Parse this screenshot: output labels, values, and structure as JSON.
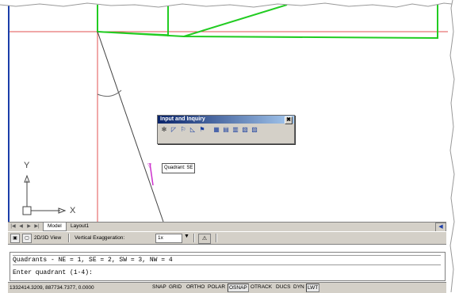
{
  "ucs": {
    "x_axis": "X",
    "y_axis": "Y"
  },
  "floating_toolbar": {
    "title": "Input and Inquiry",
    "close": "✖",
    "icons": [
      "gear-icon",
      "angle-icon",
      "flag-icon",
      "slope-icon",
      "flag-r-icon",
      "grid-a-icon",
      "grid-b-icon",
      "grid-c-icon",
      "grid-d-icon",
      "grid-e-icon"
    ]
  },
  "tooltip": {
    "text": "Quadrant: SE"
  },
  "layout_tabs": {
    "items": [
      "Model",
      "Layout1"
    ],
    "active": "Model"
  },
  "view_toolbar": {
    "view_label": "2D/3D View",
    "vert_exag_label": "Vertical Exaggeration:",
    "vert_exag_value": "1x"
  },
  "command": {
    "history": "Quadrants - NE = 1, SE = 2, SW = 3, NW = 4",
    "prompt": "Enter quadrant (1-4):"
  },
  "status": {
    "coords": "1332414.3209, 887734.7377, 0.0000",
    "buttons": [
      {
        "label": "SNAP",
        "on": false
      },
      {
        "label": "GRID",
        "on": false
      },
      {
        "label": "ORTHO",
        "on": false
      },
      {
        "label": "POLAR",
        "on": false
      },
      {
        "label": "OSNAP",
        "on": true
      },
      {
        "label": "OTRACK",
        "on": false
      },
      {
        "label": "DUCS",
        "on": false
      },
      {
        "label": "DYN",
        "on": false
      },
      {
        "label": "LWT",
        "on": true
      }
    ]
  },
  "colors": {
    "green_lines": "#22cc22",
    "red_lines": "#e05050",
    "blue_border": "#1c3ea9",
    "magenta": "#cc33cc"
  }
}
